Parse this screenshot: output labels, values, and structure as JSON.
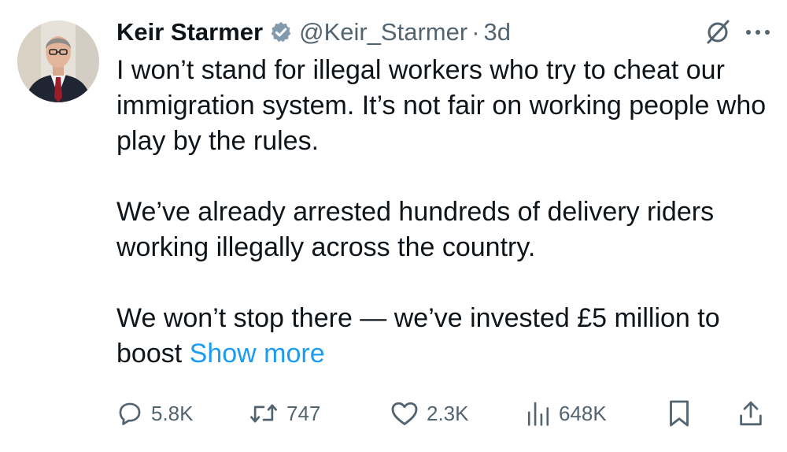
{
  "tweet": {
    "author": {
      "name": "Keir Starmer",
      "handle": "@Keir_Starmer",
      "verified": true,
      "avatar": "profile-photo"
    },
    "separator": "·",
    "timestamp": "3d",
    "text": {
      "paragraph1": "I won’t stand for illegal workers who try to cheat our immigration system. It’s not fair on working people who play by the rules.",
      "paragraph2": "We’ve already arrested hundreds of delivery riders working illegally across the country.",
      "paragraph3": "We won’t stop there — we’ve invested £5 million to boost",
      "show_more": "Show more"
    },
    "metrics": {
      "replies": "5.8K",
      "reposts": "747",
      "likes": "2.3K",
      "views": "648K"
    },
    "icons": {
      "verified": "verified-badge-icon",
      "grok": "grok-icon",
      "more": "more-options-icon",
      "reply": "reply-icon",
      "repost": "repost-icon",
      "like": "heart-icon",
      "views": "views-chart-icon",
      "bookmark": "bookmark-icon",
      "share": "share-icon"
    },
    "colors": {
      "text": "#0f1419",
      "secondary": "#536471",
      "link": "#1d9bf0"
    }
  }
}
